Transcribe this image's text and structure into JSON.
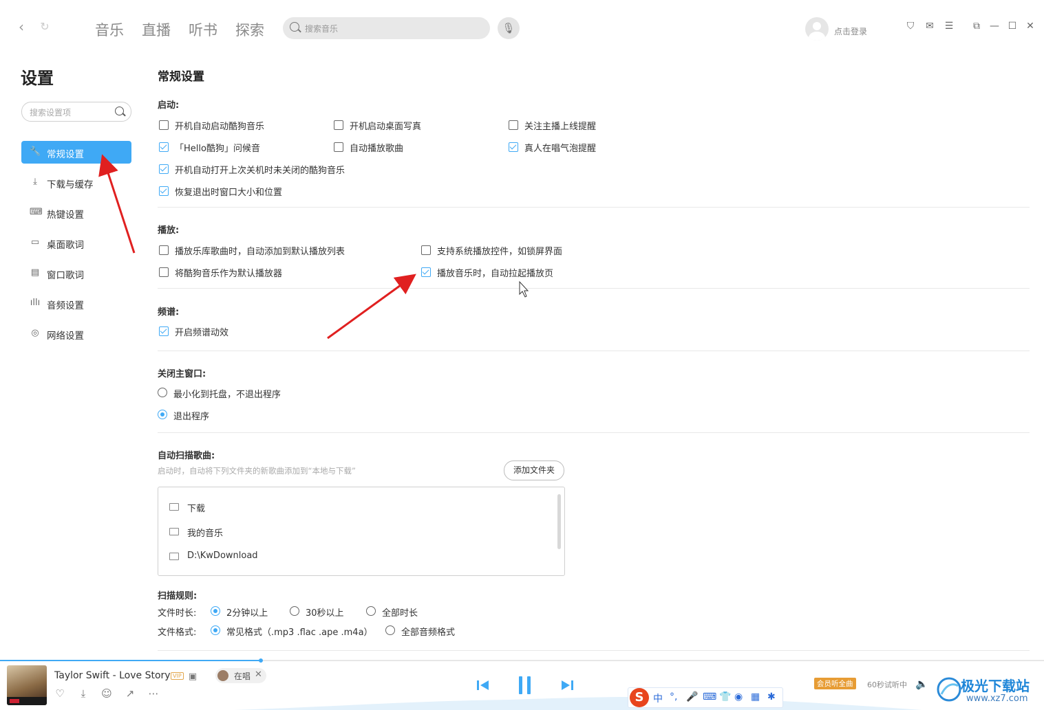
{
  "topbar": {
    "tabs": [
      "音乐",
      "直播",
      "听书",
      "探索"
    ],
    "search_placeholder": "搜索音乐",
    "login_label": "点击登录"
  },
  "sidebar": {
    "title": "设置",
    "search_placeholder": "搜索设置项",
    "items": [
      {
        "label": "常规设置",
        "icon": "wrench-icon",
        "active": true
      },
      {
        "label": "下载与缓存",
        "icon": "download-icon"
      },
      {
        "label": "热键设置",
        "icon": "keyboard-icon"
      },
      {
        "label": "桌面歌词",
        "icon": "desktop-lyrics-icon"
      },
      {
        "label": "窗口歌词",
        "icon": "window-lyrics-icon"
      },
      {
        "label": "音频设置",
        "icon": "audio-wave-icon"
      },
      {
        "label": "网络设置",
        "icon": "network-icon"
      }
    ]
  },
  "content": {
    "title": "常规设置",
    "startup": {
      "label": "启动:",
      "options": [
        {
          "text": "开机自动启动酷狗音乐",
          "checked": false
        },
        {
          "text": "开机启动桌面写真",
          "checked": false
        },
        {
          "text": "关注主播上线提醒",
          "checked": false
        },
        {
          "text": "「Hello酷狗」问候音",
          "checked": true
        },
        {
          "text": "自动播放歌曲",
          "checked": false
        },
        {
          "text": "真人在唱气泡提醒",
          "checked": true
        },
        {
          "text": "开机自动打开上次关机时未关闭的酷狗音乐",
          "checked": true
        },
        {
          "text": "恢复退出时窗口大小和位置",
          "checked": true
        }
      ]
    },
    "playback": {
      "label": "播放:",
      "options": [
        {
          "text": "播放乐库歌曲时，自动添加到默认播放列表",
          "checked": false
        },
        {
          "text": "支持系统播放控件，如锁屏界面",
          "checked": false
        },
        {
          "text": "将酷狗音乐作为默认播放器",
          "checked": false
        },
        {
          "text": "播放音乐时，自动拉起播放页",
          "checked": true
        }
      ]
    },
    "spectrum": {
      "label": "频谱:",
      "options": [
        {
          "text": "开启频谱动效",
          "checked": true
        }
      ]
    },
    "close_window": {
      "label": "关闭主窗口:",
      "options": [
        {
          "text": "最小化到托盘，不退出程序",
          "selected": false
        },
        {
          "text": "退出程序",
          "selected": true
        }
      ]
    },
    "auto_scan": {
      "label": "自动扫描歌曲:",
      "hint": "启动时，自动将下列文件夹的新歌曲添加到“本地与下载”",
      "add_button": "添加文件夹",
      "folders": [
        "下载",
        "我的音乐",
        "D:\\KwDownload"
      ]
    },
    "scan_rules": {
      "label": "扫描规则:",
      "duration_label": "文件时长:",
      "duration_options": [
        {
          "text": "2分钟以上",
          "selected": true
        },
        {
          "text": "30秒以上",
          "selected": false
        },
        {
          "text": "全部时长",
          "selected": false
        }
      ],
      "format_label": "文件格式:",
      "format_options": [
        {
          "text": "常见格式（.mp3 .flac .ape .m4a）",
          "selected": true
        },
        {
          "text": "全部音频格式",
          "selected": false
        }
      ]
    }
  },
  "player": {
    "song": "Taylor Swift - Love Story",
    "vip_badge": "VIP",
    "singing_label": "在唱",
    "member_badge": "会员听全曲",
    "trial_text": "60秒试听中",
    "progress": 0.25,
    "accent": "#3fa9f5"
  },
  "ime": {
    "logo": "S",
    "lang": "中"
  },
  "watermark": {
    "title": "极光下载站",
    "url": "www.xz7.com"
  }
}
